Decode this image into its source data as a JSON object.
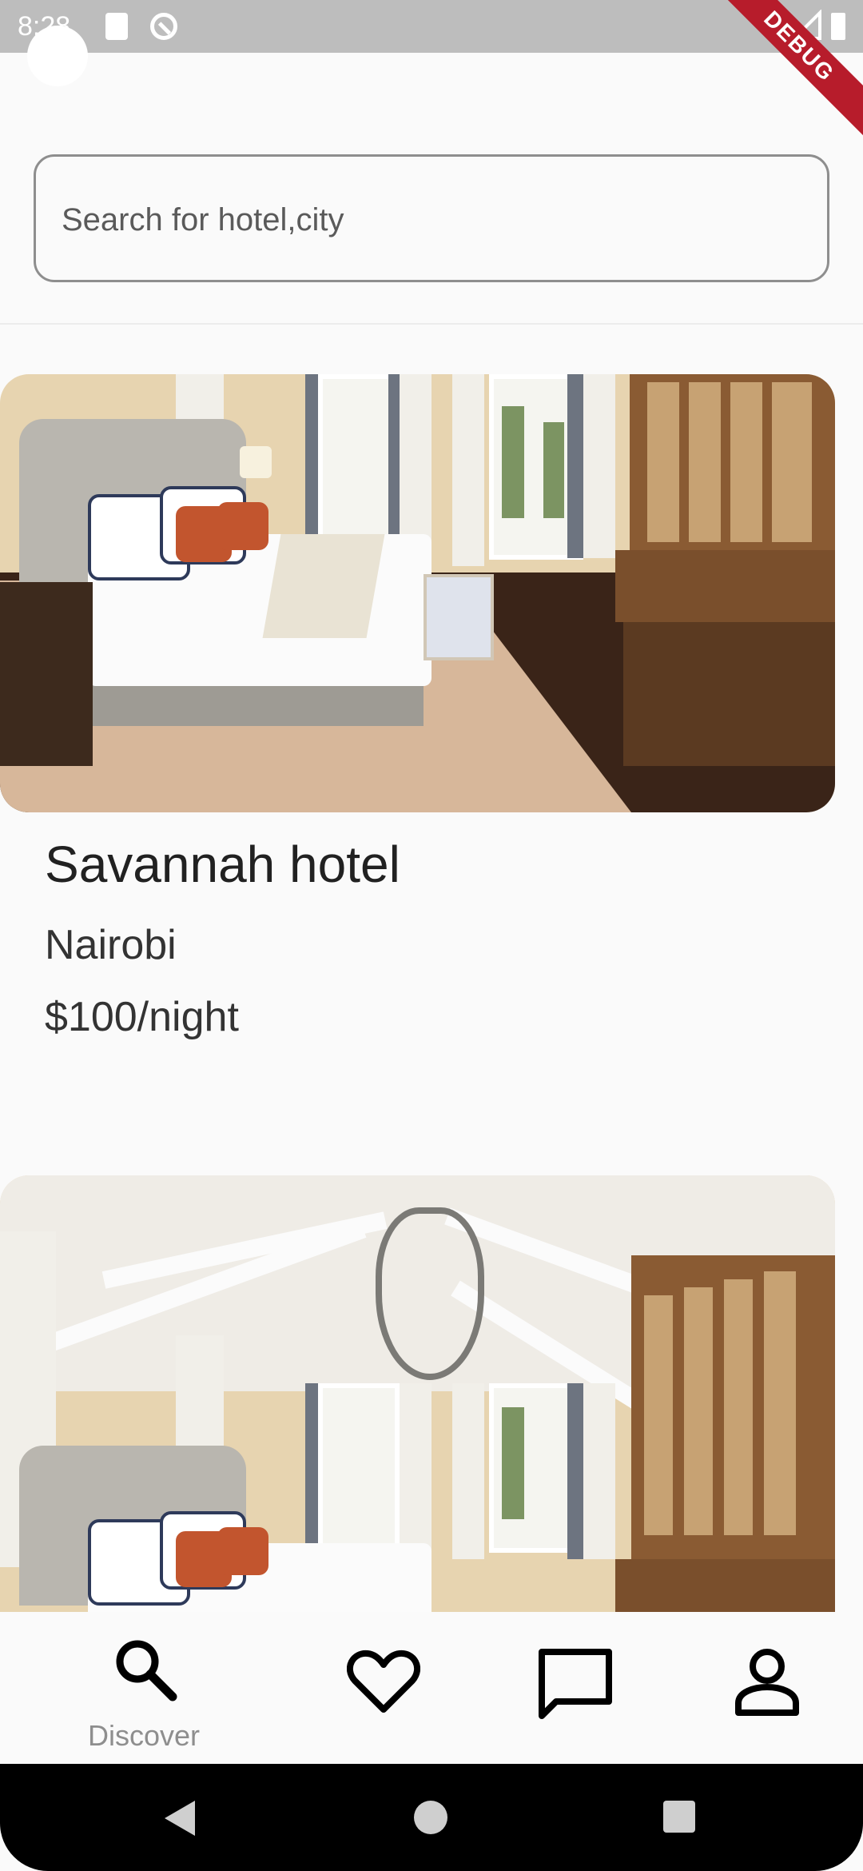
{
  "status_bar": {
    "time": "8:28"
  },
  "debug_banner": "DEBUG",
  "search": {
    "placeholder": "Search for hotel,city"
  },
  "hotels": [
    {
      "name": "Savannah hotel",
      "city": "Nairobi",
      "price": "$100/night"
    }
  ],
  "bottom_nav": {
    "items": [
      {
        "icon": "search-icon",
        "label": "Discover",
        "active": true
      },
      {
        "icon": "heart-icon",
        "label": ""
      },
      {
        "icon": "chat-icon",
        "label": ""
      },
      {
        "icon": "person-icon",
        "label": ""
      }
    ]
  }
}
